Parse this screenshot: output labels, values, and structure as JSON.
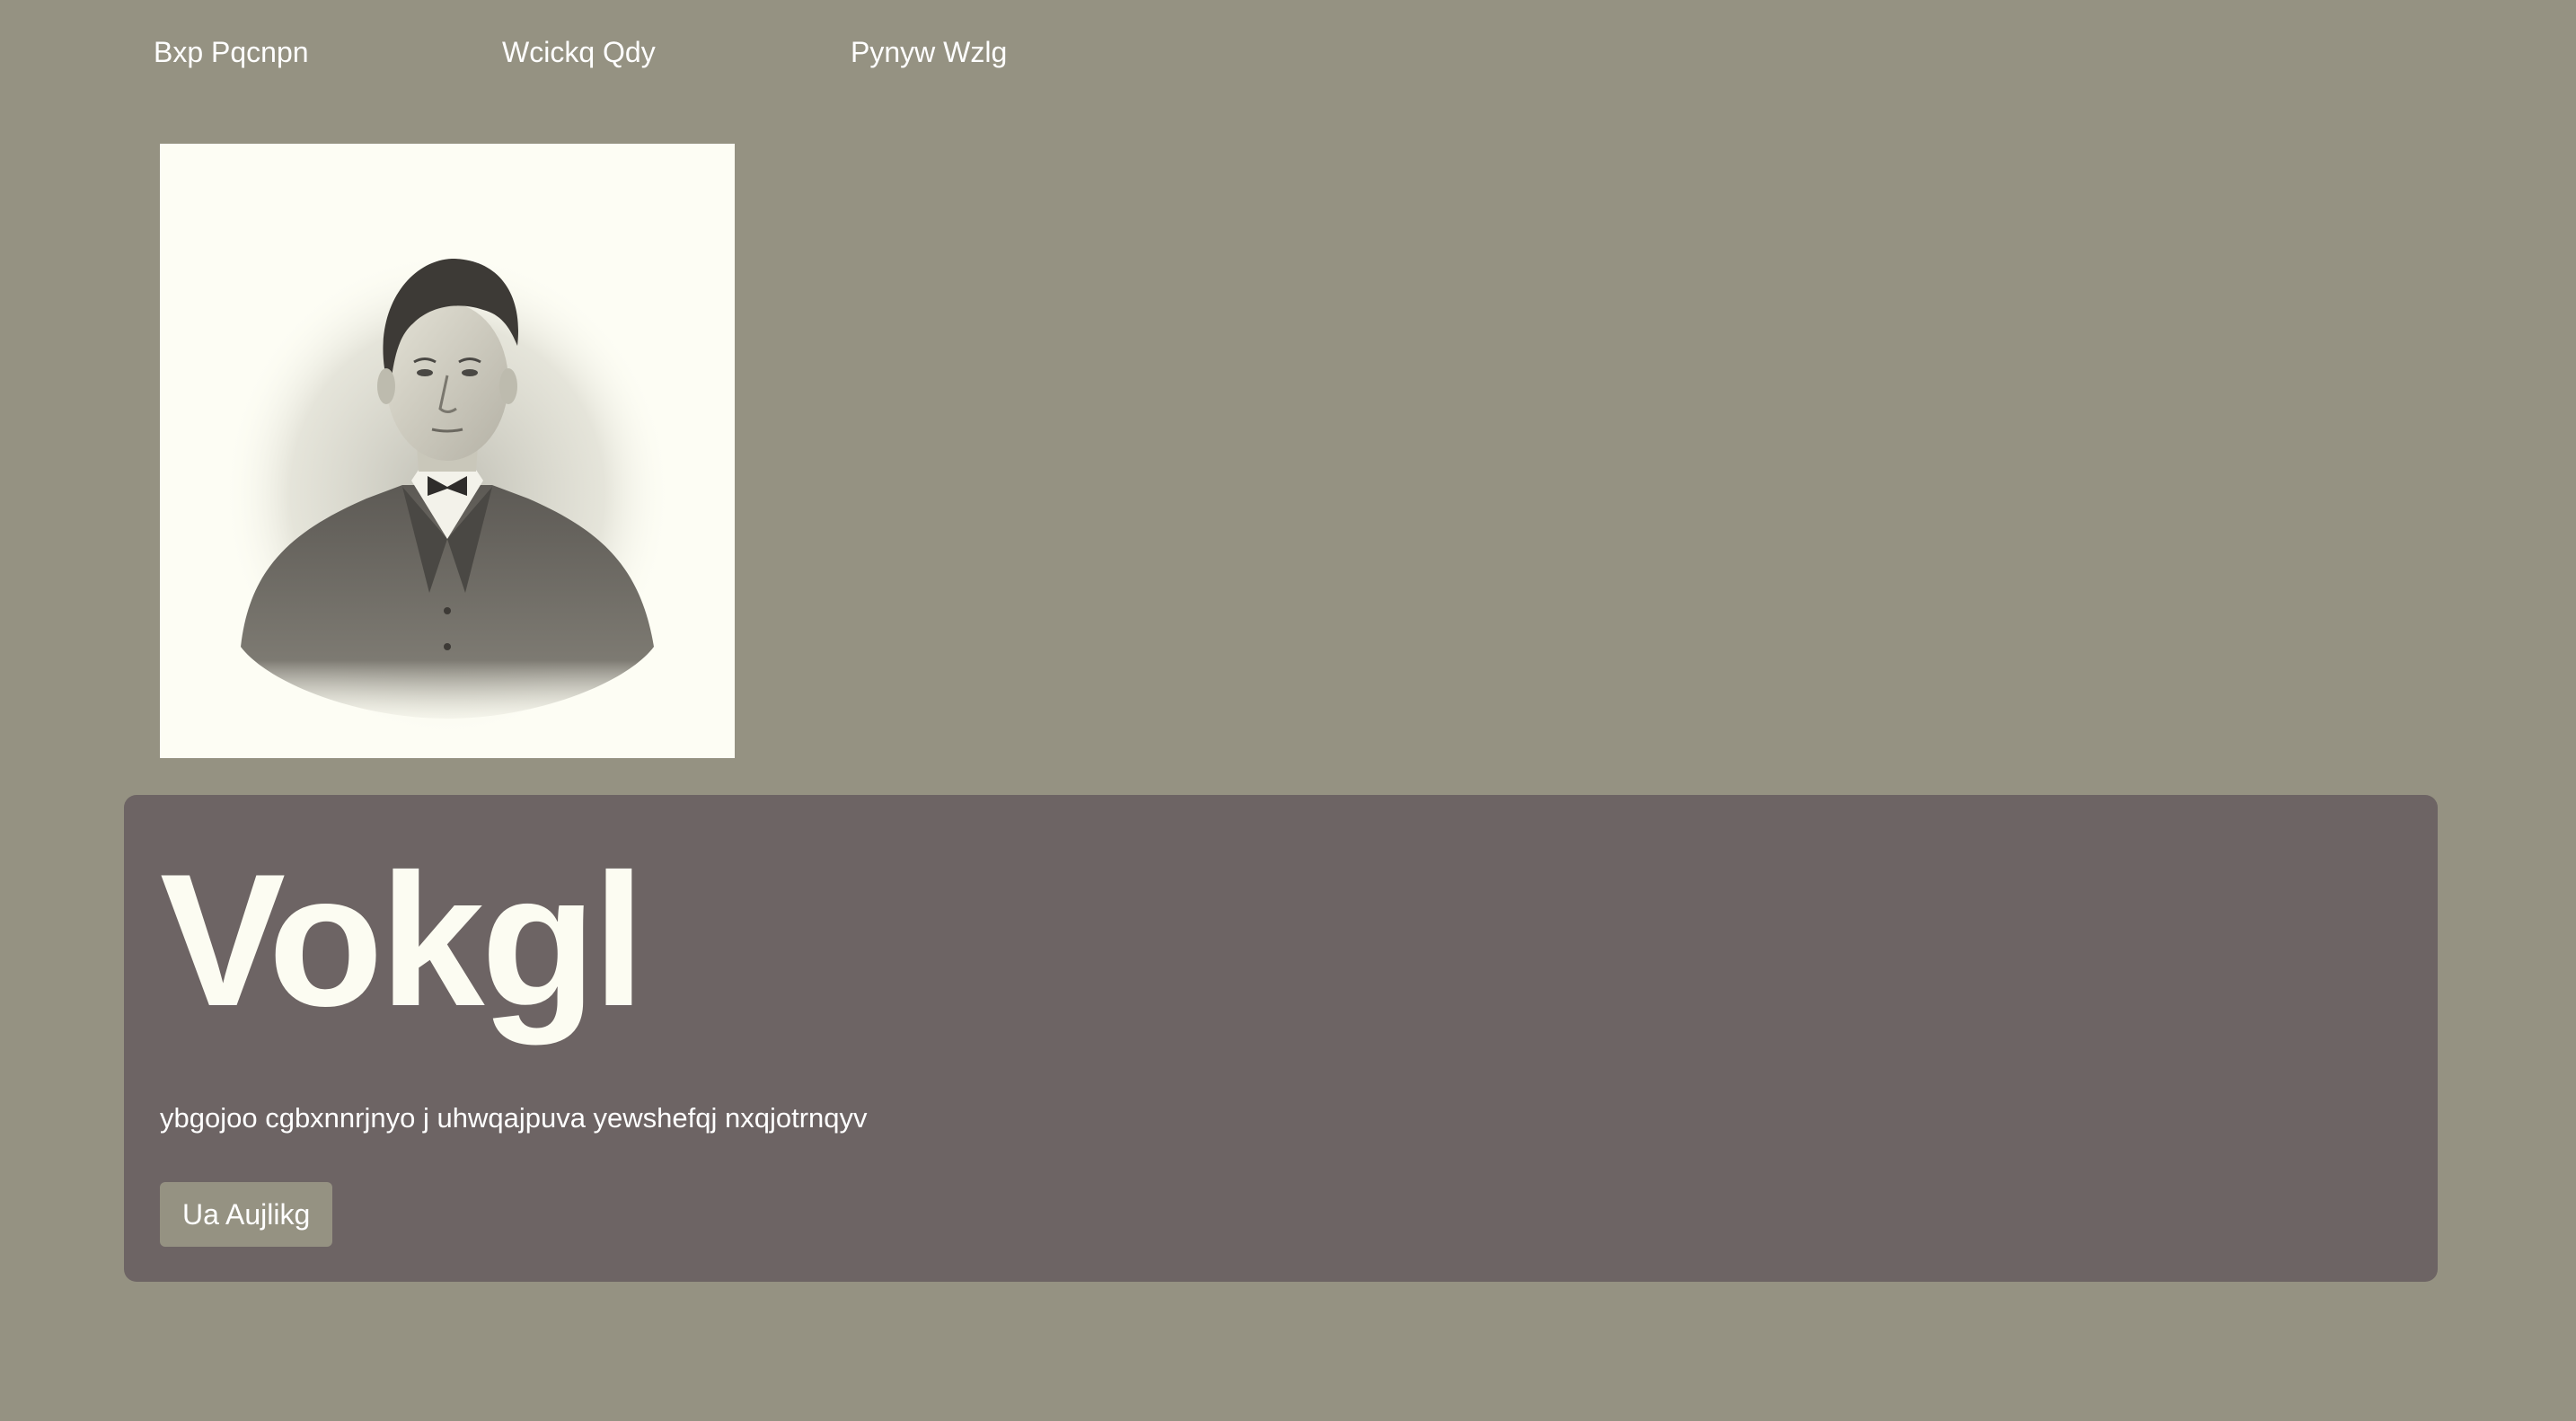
{
  "nav": {
    "items": [
      {
        "label": "Bxp Pqcnpn"
      },
      {
        "label": "Wcickq Qdy"
      },
      {
        "label": "Pynyw Wzlg"
      }
    ]
  },
  "portrait": {
    "alt": "Engraved portrait of a man in a suit"
  },
  "hero": {
    "title": "Vokgl",
    "subtitle": "ybgojoo cgbxnnrjnyo j uhwqajpuva yewshefqj nxqjotrnqyv",
    "button_label": "Ua Aujlikg"
  },
  "colors": {
    "page_background": "#959282",
    "hero_background": "#6d6464",
    "button_background": "#959282",
    "portrait_background": "#fdfdf4",
    "text": "#ffffff"
  }
}
